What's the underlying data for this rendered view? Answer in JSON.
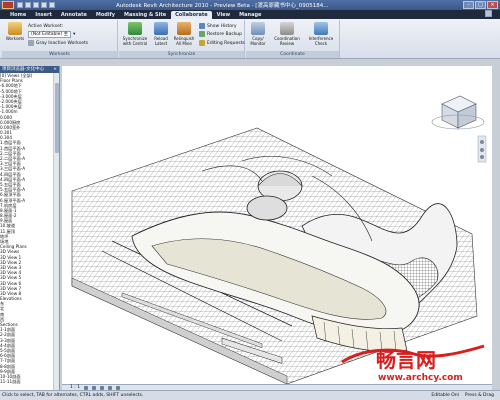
{
  "window": {
    "title": "Autodesk Revit Architecture 2010 - Preview Beta - [渡高原藏书中心_0905184...",
    "controls": [
      "minimize",
      "maximize",
      "close"
    ]
  },
  "tabs": [
    {
      "label": "Home",
      "active": false
    },
    {
      "label": "Insert",
      "active": false
    },
    {
      "label": "Annotate",
      "active": false
    },
    {
      "label": "Modify",
      "active": false
    },
    {
      "label": "Massing & Site",
      "active": false
    },
    {
      "label": "Collaborate",
      "active": true
    },
    {
      "label": "View",
      "active": false
    },
    {
      "label": "Manage",
      "active": false
    }
  ],
  "ribbon": {
    "worksets_panel": {
      "title": "Worksets",
      "button": "Worksets",
      "active_workset_label": "Active Workset:",
      "active_workset_value": "(Not Editable) 主",
      "gray_inactive": "Gray Inactive Worksets"
    },
    "synchronize_panel": {
      "title": "Synchronize",
      "sync_button": "Synchronize with Central",
      "reload_button": "Reload Latest",
      "relinquish_button": "Relinquish All Mine",
      "show_history": "Show History",
      "restore_backup": "Restore Backup",
      "editing_requests": "Editing Requests"
    },
    "coordinate_panel": {
      "title": "Coordinate",
      "copy_monitor": "Copy/ Monitor",
      "coordination_review": "Coordination Review",
      "interference_check": "Interference Check"
    }
  },
  "project_browser": {
    "title": "项目浏览器-文化中心_0905...",
    "items": [
      "[0] Views (全部)",
      "  Floor Plans",
      "    -6.000地下",
      "    -5.000地下",
      "    -3.000夹层",
      "    -2.000夹层",
      "    -1.000夹层",
      "    -1.000m",
      "    0.000",
      "    0.000厨房",
      "    0.000室外",
      "    0.301",
      "    0.304",
      "    1.首层平面",
      "    1.首层平面-A",
      "    2.二层平面",
      "    2.二层平面-A",
      "    3.三层平面",
      "    3.三层平面-A",
      "    4.四层平面",
      "    4.四层平面-A",
      "    5.五层平面",
      "    5.五层平面-A",
      "    6.屋顶平面",
      "    6.屋顶平面-A",
      "    7.机房层",
      "    8.屋面-1",
      "    8.屋面-2",
      "    9.屋面",
      "    10.坡道",
      "    11.屋顶",
      "    地坪",
      "    场地",
      "  Ceiling Plans",
      "  3D Views",
      "    3D View 1",
      "    3D View 2",
      "    3D View 3",
      "    3D View 4",
      "    3D View 5",
      "    3D View 6",
      "    3D View 7",
      "    3D View 8",
      "  Elevations",
      "    东",
      "    北",
      "    南",
      "    西",
      "  Sections",
      "    1-1剖面",
      "    2-2剖面",
      "    3-3剖面",
      "    4-4剖面",
      "    5-5剖面",
      "    6-6剖面",
      "    7-7剖面",
      "    8-8剖面",
      "    9-9剖面",
      "    10-10剖面",
      "    11-11剖面"
    ]
  },
  "viewbar": {
    "scale": "1 : 1"
  },
  "statusbar": {
    "hint": "Click to select, TAB for alternates, CTRL adds, SHIFT unselects.",
    "editable": "Editable Onl",
    "press_drag": "Press & Drag"
  },
  "watermark": {
    "brand": "畅言网",
    "url": "www.archcy.com"
  },
  "colors": {
    "title_bg": "#3b5786",
    "tab_bar_bg": "#1f2b3d",
    "watermark_red": "#d81e1e"
  }
}
